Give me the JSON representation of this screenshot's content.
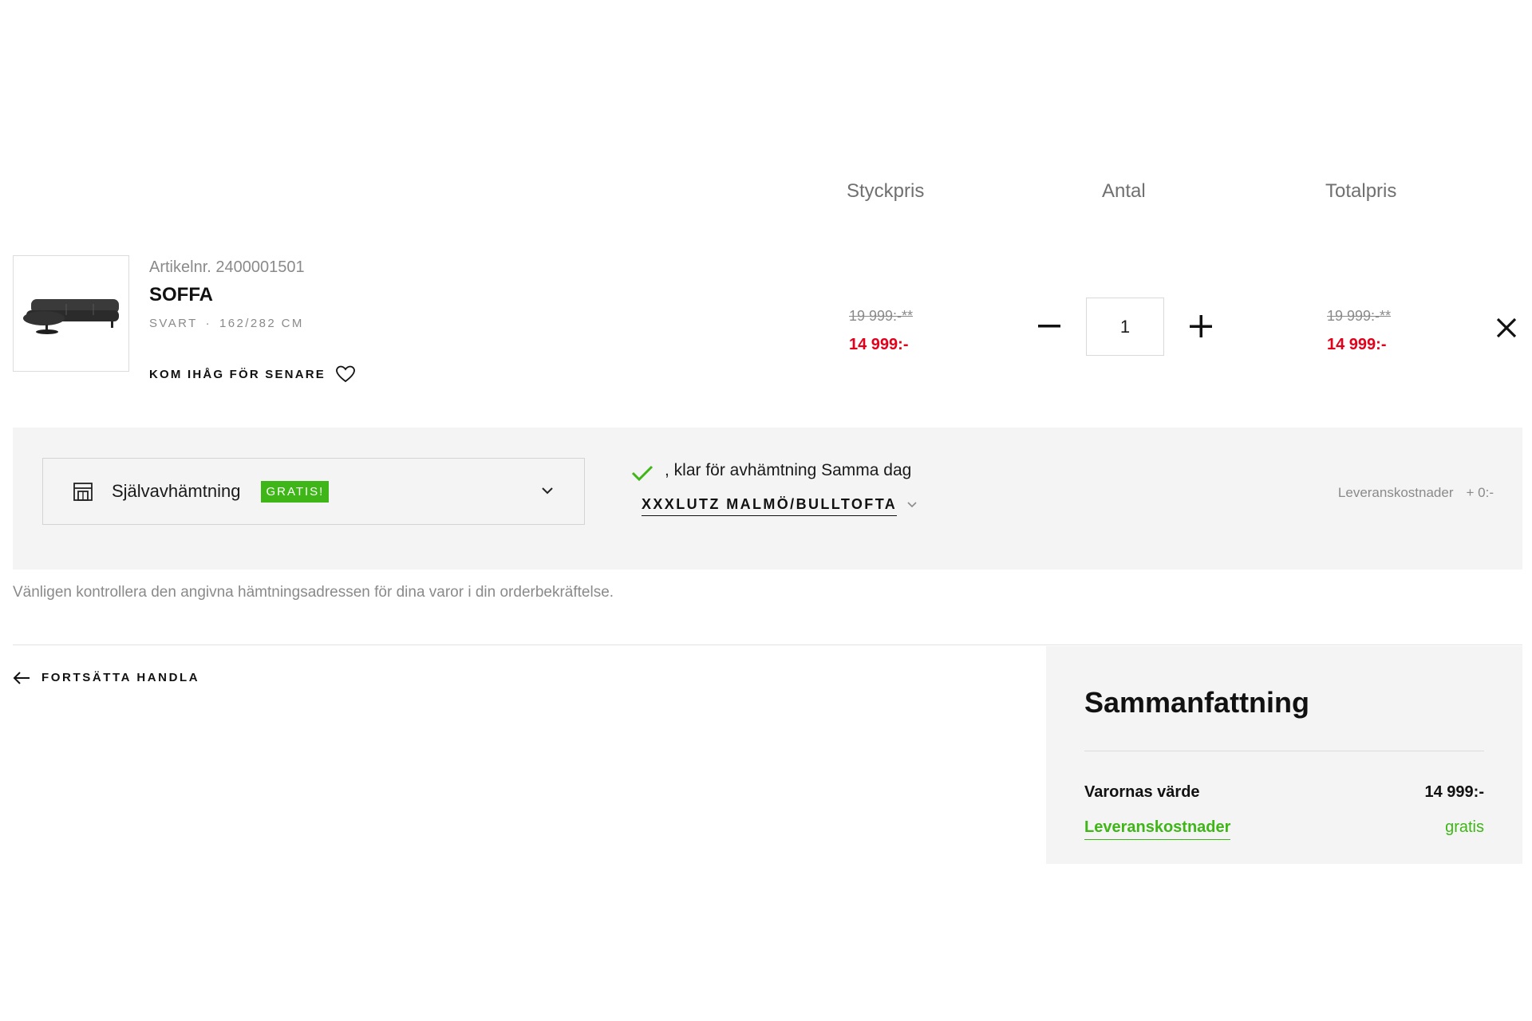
{
  "columns": {
    "unit_price": "Styckpris",
    "quantity": "Antal",
    "total_price": "Totalpris"
  },
  "product": {
    "article_no": "Artikelnr. 2400001501",
    "name": "SOFFA",
    "color": "SVART",
    "separator": "·",
    "size": "162/282 CM",
    "save_for_later": "KOM IHÅG FÖR SENARE",
    "unit_old_price": "19 999:-**",
    "unit_new_price": "14 999:-",
    "quantity": "1",
    "total_old_price": "19 999:-**",
    "total_new_price": "14 999:-"
  },
  "delivery": {
    "method": "Självavhämtning",
    "badge": "GRATIS!",
    "status": ", klar för avhämtning Samma dag",
    "store": "XXXLUTZ MALMÖ/BULLTOFTA",
    "cost_label": "Leveranskostnader",
    "cost_value": "+ 0:-"
  },
  "notice": "Vänligen kontrollera den angivna hämtningsadressen för dina varor i din orderbekräftelse.",
  "continue_shopping": "FORTSÄTTA HANDLA",
  "summary": {
    "title": "Sammanfattning",
    "goods_label": "Varornas värde",
    "goods_value": "14 999:-",
    "delivery_label": "Leveranskostnader",
    "delivery_value": "gratis"
  },
  "colors": {
    "sale_red": "#e2001a",
    "accent_green": "#3fb618",
    "panel_gray": "#f4f4f4"
  },
  "icons": [
    "sofa-thumbnail",
    "heart-icon",
    "minus-icon",
    "plus-icon",
    "close-icon",
    "store-icon",
    "chevron-down-icon",
    "checkmark-icon",
    "arrow-left-icon"
  ]
}
